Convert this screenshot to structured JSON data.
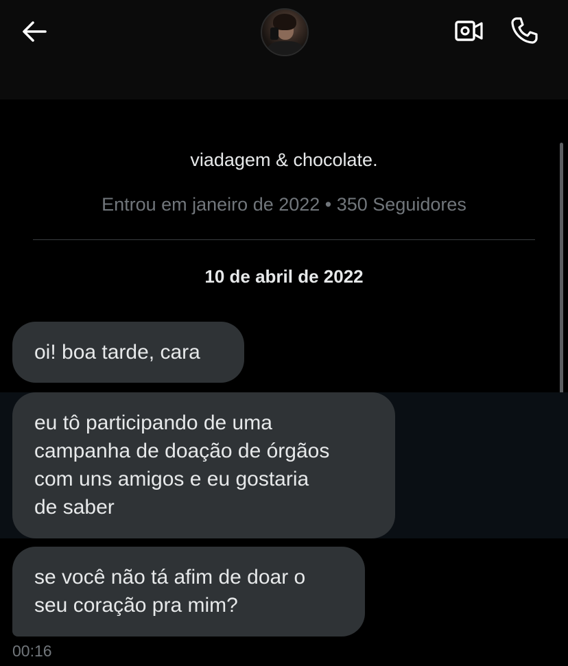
{
  "header": {
    "back_icon": "arrow-left-icon",
    "video_icon": "video-camera-icon",
    "call_icon": "phone-icon"
  },
  "profile": {
    "bio": "viadagem & chocolate.",
    "meta": "Entrou em janeiro de 2022 • 350 Seguidores"
  },
  "conversation": {
    "date": "10 de abril de 2022",
    "messages": [
      {
        "text": "oi! boa tarde, cara"
      },
      {
        "text": "eu tô participando de uma\ncampanha de doação de órgãos\ncom uns amigos e eu gostaria\nde saber"
      },
      {
        "text": "se você não tá afim de doar o\nseu coração pra mim?"
      }
    ],
    "timestamp": "00:16"
  },
  "colors": {
    "background": "#000000",
    "header": "#0b0b0b",
    "bubble": "#2f3336",
    "text": "#e7e9ea",
    "muted": "#71767b"
  }
}
